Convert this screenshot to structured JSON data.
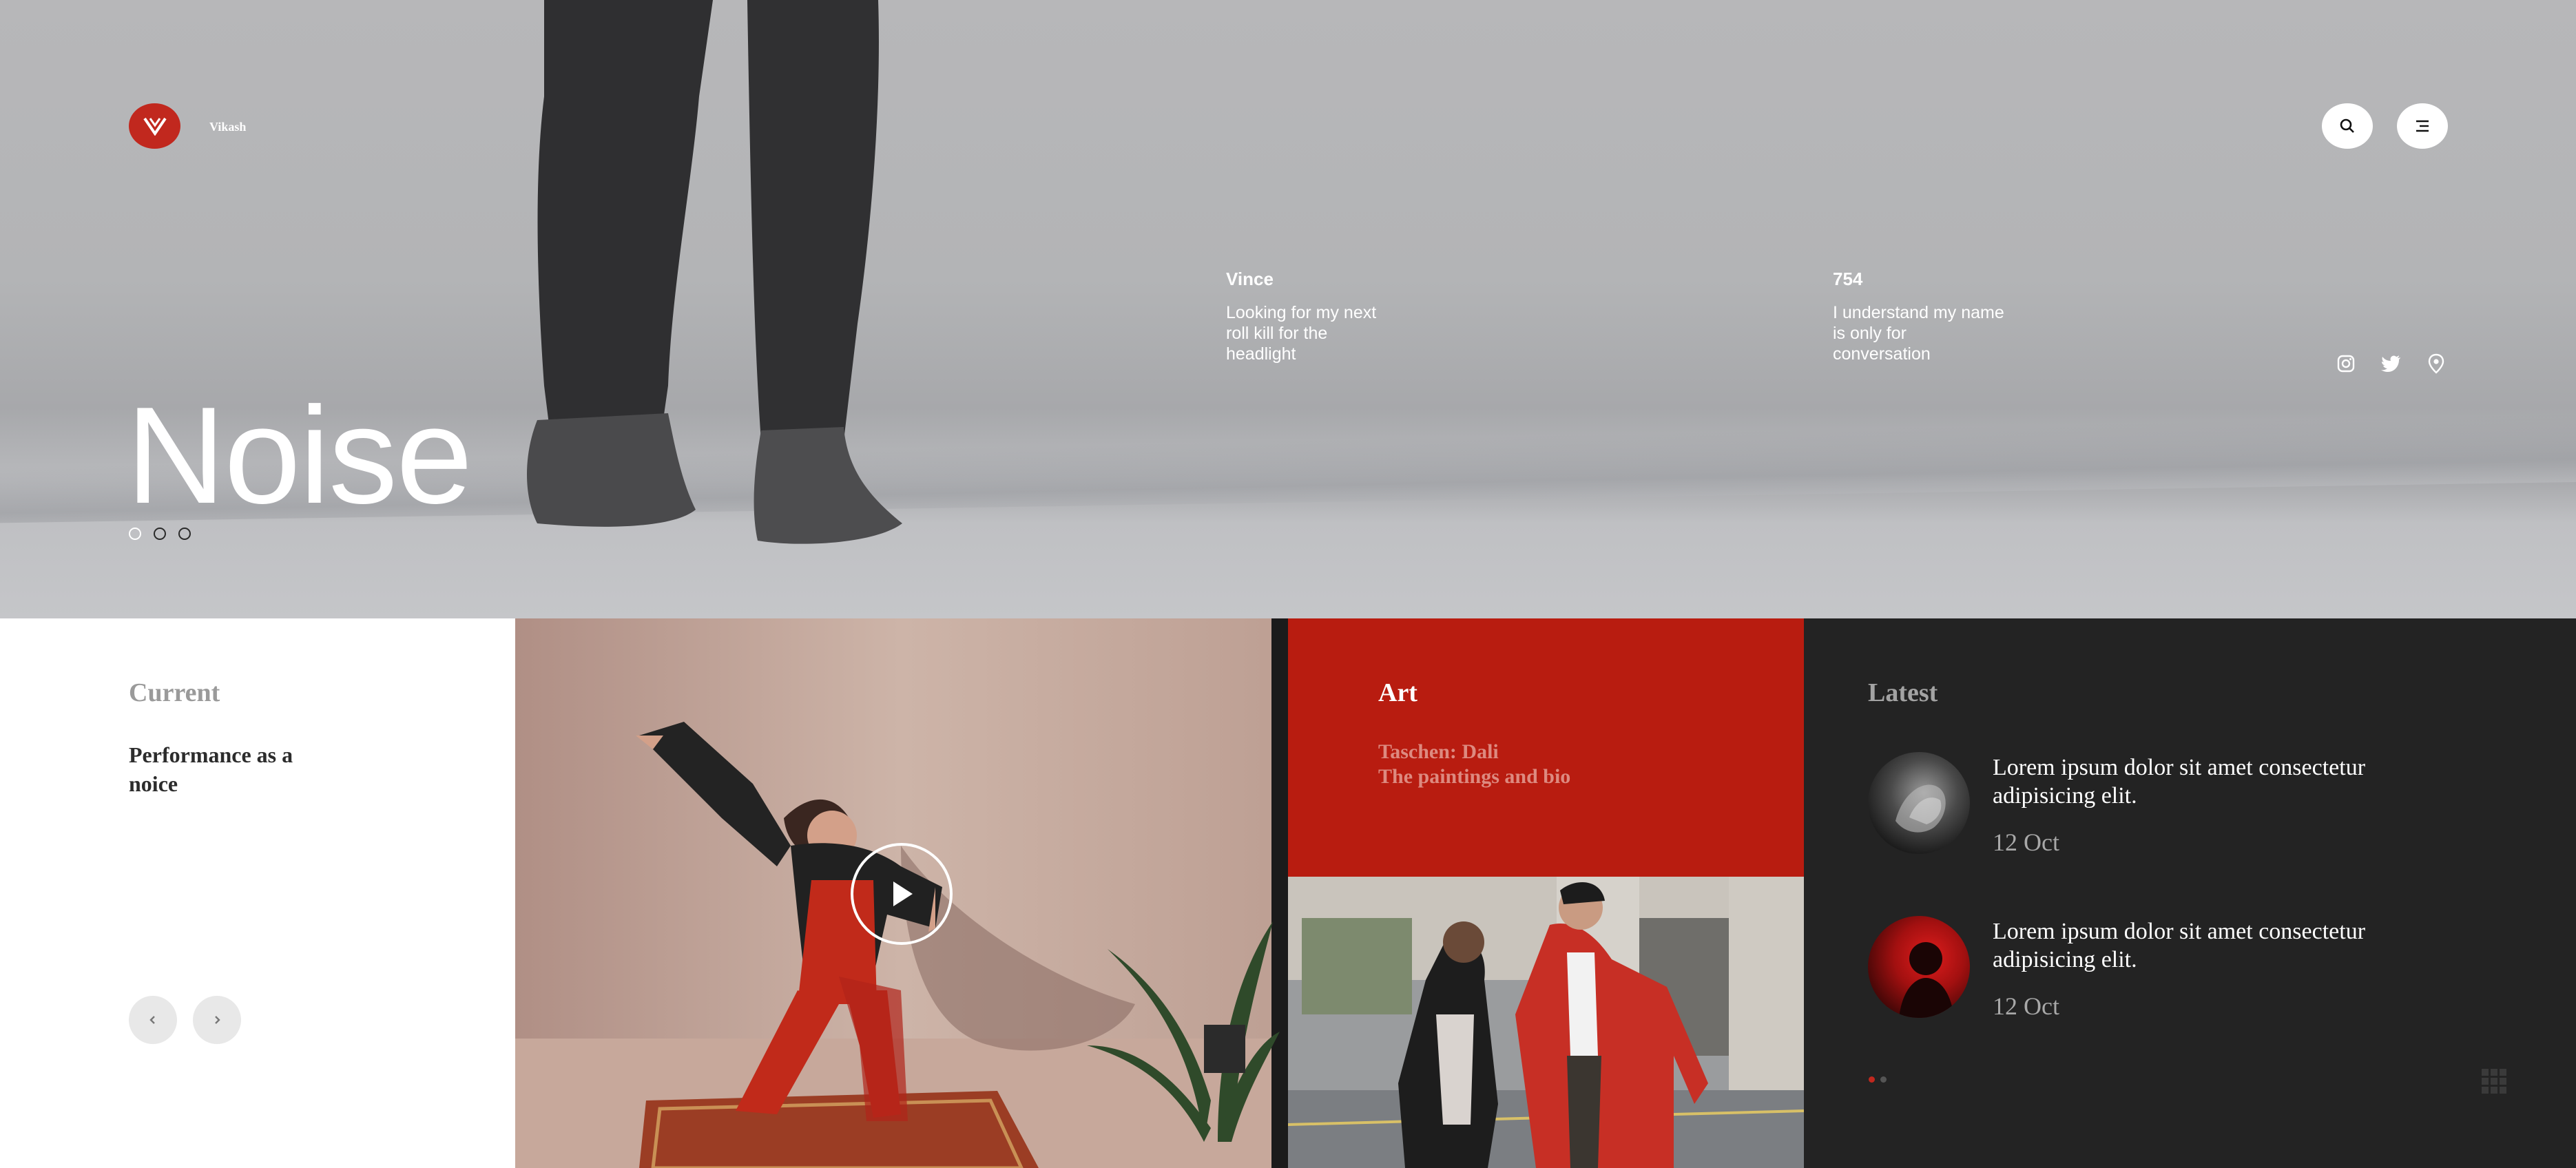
{
  "brand": {
    "name": "Vikash"
  },
  "hero": {
    "title": "Noise",
    "info": [
      {
        "title": "Vince",
        "text": "Looking for my next roll kill for the headlight"
      },
      {
        "title": "754",
        "text": "I understand my name is only for conversation"
      }
    ],
    "social": [
      "instagram-icon",
      "twitter-icon",
      "location-pin-icon"
    ],
    "slides": 3,
    "active_slide": 1
  },
  "current": {
    "label": "Current",
    "title": "Performance as a noice"
  },
  "art": {
    "label": "Art",
    "subtitle_line1": "Taschen: Dali",
    "subtitle_line2": "The paintings and bio"
  },
  "latest": {
    "label": "Latest",
    "items": [
      {
        "title": "Lorem ipsum dolor sit amet consectetur adipisicing elit.",
        "date": "12 Oct"
      },
      {
        "title": "Lorem ipsum dolor sit amet consectetur adipisicing elit.",
        "date": "12 Oct"
      }
    ]
  },
  "colors": {
    "accent": "#c1281e",
    "art_panel": "#b81c10",
    "dark_panel": "#232323"
  }
}
